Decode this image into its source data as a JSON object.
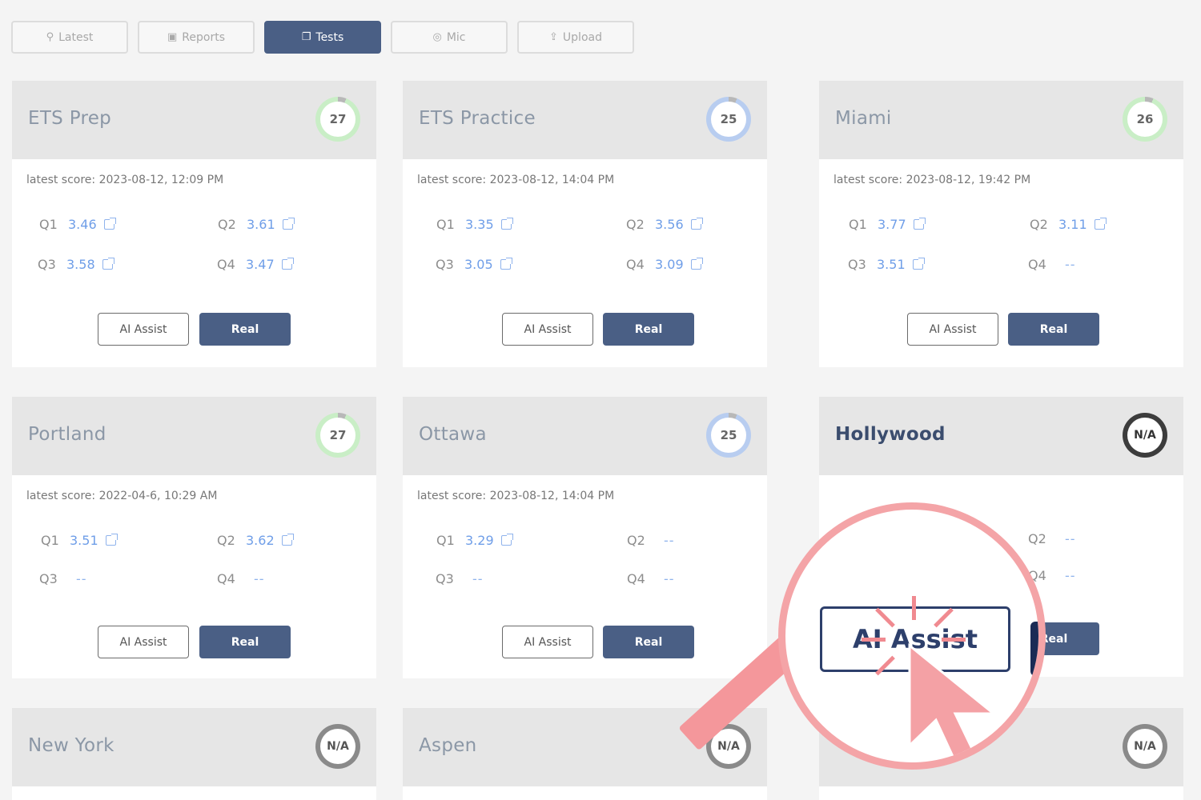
{
  "tabs": [
    {
      "label": "Latest",
      "icon": "pin-icon",
      "active": false
    },
    {
      "label": "Reports",
      "icon": "chart-icon",
      "active": false
    },
    {
      "label": "Tests",
      "icon": "tests-icon",
      "active": true
    },
    {
      "label": "Mic",
      "icon": "mic-icon",
      "active": false
    },
    {
      "label": "Upload",
      "icon": "upload-icon",
      "active": false
    }
  ],
  "buttons": {
    "ai_assist": "AI Assist",
    "real": "Real"
  },
  "magnifier": {
    "label": "AI Assist",
    "real_partial": "eal"
  },
  "cards": [
    {
      "title": "ETS Prep",
      "count": "27",
      "latest": "latest score: 2023-08-12, 12:09 PM",
      "q": [
        {
          "label": "Q1",
          "score": "3.46"
        },
        {
          "label": "Q2",
          "score": "3.61"
        },
        {
          "label": "Q3",
          "score": "3.58"
        },
        {
          "label": "Q4",
          "score": "3.47"
        }
      ]
    },
    {
      "title": "ETS Practice",
      "count": "25",
      "latest": "latest score: 2023-08-12, 14:04 PM",
      "q": [
        {
          "label": "Q1",
          "score": "3.35"
        },
        {
          "label": "Q2",
          "score": "3.56"
        },
        {
          "label": "Q3",
          "score": "3.05"
        },
        {
          "label": "Q4",
          "score": "3.09"
        }
      ]
    },
    {
      "title": "Miami",
      "count": "26",
      "latest": "latest score: 2023-08-12, 19:42 PM",
      "q": [
        {
          "label": "Q1",
          "score": "3.77"
        },
        {
          "label": "Q2",
          "score": "3.11"
        },
        {
          "label": "Q3",
          "score": "3.51"
        },
        {
          "label": "Q4",
          "score": "--"
        }
      ]
    },
    {
      "title": "Portland",
      "count": "27",
      "latest": "latest score: 2022-04-6, 10:29 AM",
      "q": [
        {
          "label": "Q1",
          "score": "3.51"
        },
        {
          "label": "Q2",
          "score": "3.62"
        },
        {
          "label": "Q3",
          "score": "--"
        },
        {
          "label": "Q4",
          "score": "--"
        }
      ]
    },
    {
      "title": "Ottawa",
      "count": "25",
      "latest": "latest score: 2023-08-12, 14:04 PM",
      "q": [
        {
          "label": "Q1",
          "score": "3.29"
        },
        {
          "label": "Q2",
          "score": "--"
        },
        {
          "label": "Q3",
          "score": "--"
        },
        {
          "label": "Q4",
          "score": "--"
        }
      ]
    },
    {
      "title": "Hollywood",
      "count": "N/A",
      "q": [
        {
          "label": "Q2",
          "score": "--"
        },
        {
          "label": "Q4",
          "score": "--"
        }
      ]
    },
    {
      "title": "New York",
      "count": "N/A"
    },
    {
      "title": "Aspen",
      "count": "N/A"
    },
    {
      "title": "",
      "count": "N/A"
    }
  ],
  "colors": {
    "primary": "#4a5f85",
    "link": "#6f9ee8",
    "magnifier": "#f4a4a7"
  }
}
